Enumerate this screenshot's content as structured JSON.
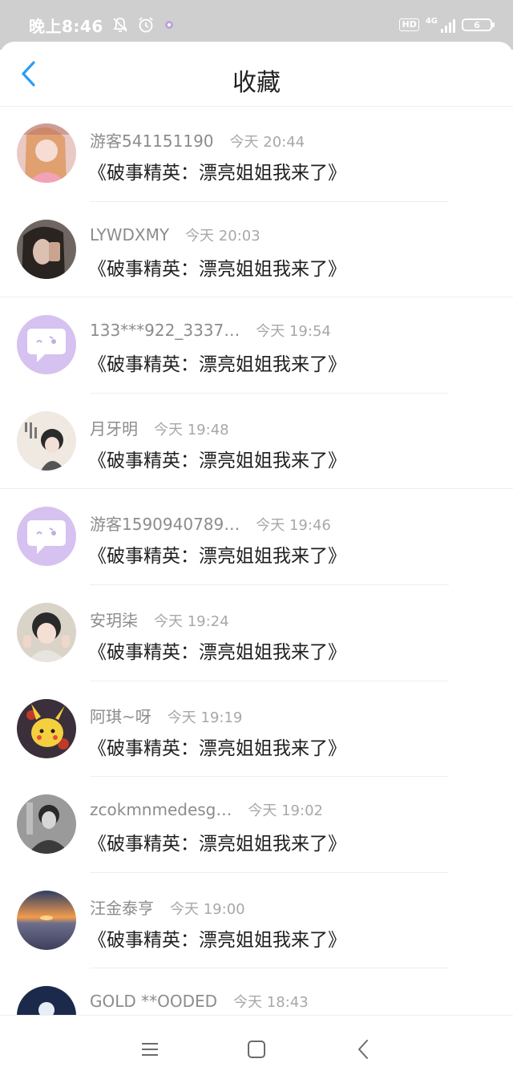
{
  "status_bar": {
    "time": "晚上8:46",
    "hd": "HD",
    "network": "4G",
    "battery": "6",
    "icons": [
      "mute-bell-icon",
      "alarm-icon",
      "app-notification-icon",
      "hd-icon",
      "signal-icon",
      "battery-icon"
    ]
  },
  "header": {
    "title": "收藏",
    "back_icon": "chevron-left-icon",
    "accent_color": "#2a9df4"
  },
  "favorites": [
    {
      "username": "游客541151190",
      "time": "今天 20:44",
      "title": "《破事精英：漂亮姐姐我来了》",
      "avatar": "photo"
    },
    {
      "username": "LYWDXMY",
      "time": "今天 20:03",
      "title": "《破事精英：漂亮姐姐我来了》",
      "avatar": "photo"
    },
    {
      "username": "133***922_3337…",
      "time": "今天 19:54",
      "title": "《破事精英：漂亮姐姐我来了》",
      "avatar": "default"
    },
    {
      "username": "月牙明",
      "time": "今天 19:48",
      "title": "《破事精英：漂亮姐姐我来了》",
      "avatar": "photo"
    },
    {
      "username": "游客1590940789…",
      "time": "今天 19:46",
      "title": "《破事精英：漂亮姐姐我来了》",
      "avatar": "default"
    },
    {
      "username": "安玥柒",
      "time": "今天 19:24",
      "title": "《破事精英：漂亮姐姐我来了》",
      "avatar": "photo"
    },
    {
      "username": "阿琪~呀",
      "time": "今天 19:19",
      "title": "《破事精英：漂亮姐姐我来了》",
      "avatar": "photo"
    },
    {
      "username": "zcokmnmedesg…",
      "time": "今天 19:02",
      "title": "《破事精英：漂亮姐姐我来了》",
      "avatar": "photo"
    },
    {
      "username": "汪金泰亨",
      "time": "今天 19:00",
      "title": "《破事精英：漂亮姐姐我来了》",
      "avatar": "photo"
    },
    {
      "username": "GOLD **OODED",
      "time": "今天 18:43",
      "title": "",
      "avatar": "photo"
    }
  ],
  "bottom_nav": {
    "icons": [
      "menu-icon",
      "home-square-icon",
      "back-triangle-icon"
    ]
  }
}
